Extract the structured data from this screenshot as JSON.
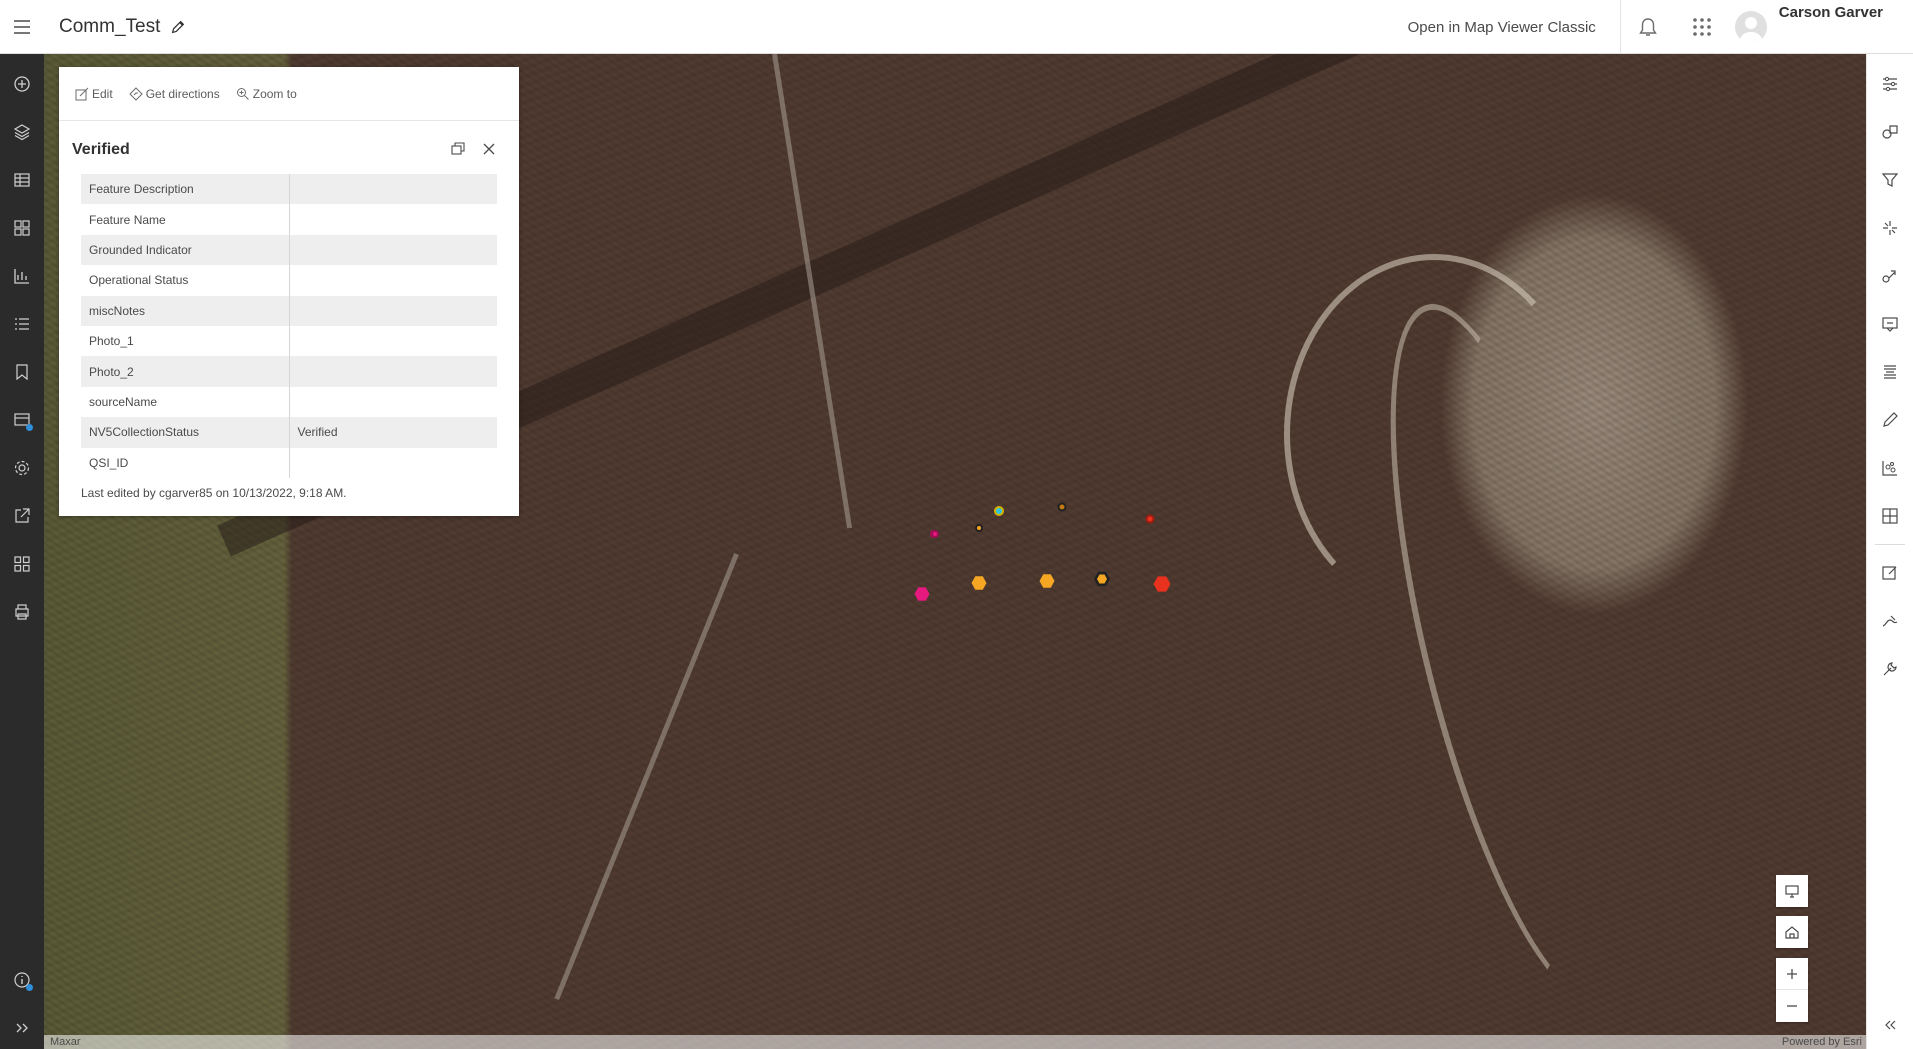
{
  "header": {
    "title": "Comm_Test",
    "open_classic": "Open in Map Viewer Classic",
    "user_name": "Carson Garver"
  },
  "left_bar": {
    "items": [
      "add-icon",
      "layers-icon",
      "table-icon",
      "basemap-icon",
      "charts-icon",
      "legend-icon",
      "bookmarks-icon",
      "analysis-icon",
      "properties-icon",
      "share-icon",
      "grid-icon",
      "print-icon"
    ],
    "bottom": [
      "info-icon",
      "expand-icon"
    ]
  },
  "right_bar": {
    "items": [
      "properties-icon",
      "styles-icon",
      "filter-icon",
      "effects-icon",
      "pop-ups-icon",
      "labels-icon",
      "fields-icon",
      "forms-icon",
      "clustering-icon",
      "aggregation-icon",
      "sketch-icon",
      "edit-icon",
      "configure-icon"
    ]
  },
  "popup": {
    "actions": {
      "edit": "Edit",
      "directions": "Get directions",
      "zoom": "Zoom to"
    },
    "title": "Verified",
    "attributes": [
      {
        "key": "Feature Description",
        "value": ""
      },
      {
        "key": "Feature Name",
        "value": ""
      },
      {
        "key": "Grounded Indicator",
        "value": ""
      },
      {
        "key": "Operational Status",
        "value": ""
      },
      {
        "key": "miscNotes",
        "value": ""
      },
      {
        "key": "Photo_1",
        "value": ""
      },
      {
        "key": "Photo_2",
        "value": ""
      },
      {
        "key": "sourceName",
        "value": ""
      },
      {
        "key": "NV5CollectionStatus",
        "value": "Verified"
      },
      {
        "key": "QSI_ID",
        "value": ""
      }
    ],
    "footer": "Last edited by cgarver85 on 10/13/2022, 9:18 AM."
  },
  "map": {
    "basemap_attribution": "Maxar",
    "powered_by": "Powered by Esri",
    "colors": {
      "orange": "#f5a623",
      "magenta": "#e6197e",
      "red": "#e8321e",
      "cyan": "#2ec4e0",
      "dark": "#222222"
    }
  }
}
